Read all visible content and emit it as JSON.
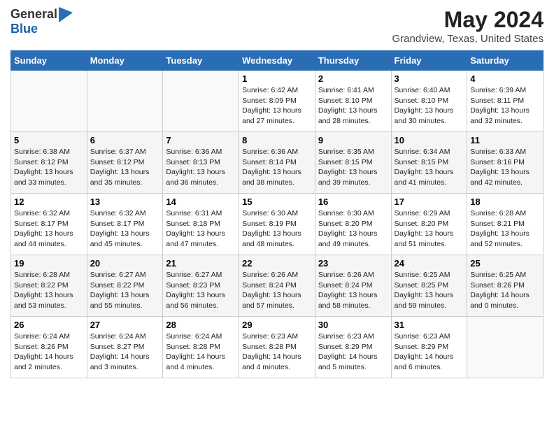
{
  "header": {
    "logo_general": "General",
    "logo_blue": "Blue",
    "title": "May 2024",
    "subtitle": "Grandview, Texas, United States"
  },
  "days_of_week": [
    "Sunday",
    "Monday",
    "Tuesday",
    "Wednesday",
    "Thursday",
    "Friday",
    "Saturday"
  ],
  "weeks": [
    [
      {
        "day": "",
        "info": ""
      },
      {
        "day": "",
        "info": ""
      },
      {
        "day": "",
        "info": ""
      },
      {
        "day": "1",
        "info": "Sunrise: 6:42 AM\nSunset: 8:09 PM\nDaylight: 13 hours and 27 minutes."
      },
      {
        "day": "2",
        "info": "Sunrise: 6:41 AM\nSunset: 8:10 PM\nDaylight: 13 hours and 28 minutes."
      },
      {
        "day": "3",
        "info": "Sunrise: 6:40 AM\nSunset: 8:10 PM\nDaylight: 13 hours and 30 minutes."
      },
      {
        "day": "4",
        "info": "Sunrise: 6:39 AM\nSunset: 8:11 PM\nDaylight: 13 hours and 32 minutes."
      }
    ],
    [
      {
        "day": "5",
        "info": "Sunrise: 6:38 AM\nSunset: 8:12 PM\nDaylight: 13 hours and 33 minutes."
      },
      {
        "day": "6",
        "info": "Sunrise: 6:37 AM\nSunset: 8:12 PM\nDaylight: 13 hours and 35 minutes."
      },
      {
        "day": "7",
        "info": "Sunrise: 6:36 AM\nSunset: 8:13 PM\nDaylight: 13 hours and 36 minutes."
      },
      {
        "day": "8",
        "info": "Sunrise: 6:36 AM\nSunset: 8:14 PM\nDaylight: 13 hours and 38 minutes."
      },
      {
        "day": "9",
        "info": "Sunrise: 6:35 AM\nSunset: 8:15 PM\nDaylight: 13 hours and 39 minutes."
      },
      {
        "day": "10",
        "info": "Sunrise: 6:34 AM\nSunset: 8:15 PM\nDaylight: 13 hours and 41 minutes."
      },
      {
        "day": "11",
        "info": "Sunrise: 6:33 AM\nSunset: 8:16 PM\nDaylight: 13 hours and 42 minutes."
      }
    ],
    [
      {
        "day": "12",
        "info": "Sunrise: 6:32 AM\nSunset: 8:17 PM\nDaylight: 13 hours and 44 minutes."
      },
      {
        "day": "13",
        "info": "Sunrise: 6:32 AM\nSunset: 8:17 PM\nDaylight: 13 hours and 45 minutes."
      },
      {
        "day": "14",
        "info": "Sunrise: 6:31 AM\nSunset: 8:18 PM\nDaylight: 13 hours and 47 minutes."
      },
      {
        "day": "15",
        "info": "Sunrise: 6:30 AM\nSunset: 8:19 PM\nDaylight: 13 hours and 48 minutes."
      },
      {
        "day": "16",
        "info": "Sunrise: 6:30 AM\nSunset: 8:20 PM\nDaylight: 13 hours and 49 minutes."
      },
      {
        "day": "17",
        "info": "Sunrise: 6:29 AM\nSunset: 8:20 PM\nDaylight: 13 hours and 51 minutes."
      },
      {
        "day": "18",
        "info": "Sunrise: 6:28 AM\nSunset: 8:21 PM\nDaylight: 13 hours and 52 minutes."
      }
    ],
    [
      {
        "day": "19",
        "info": "Sunrise: 6:28 AM\nSunset: 8:22 PM\nDaylight: 13 hours and 53 minutes."
      },
      {
        "day": "20",
        "info": "Sunrise: 6:27 AM\nSunset: 8:22 PM\nDaylight: 13 hours and 55 minutes."
      },
      {
        "day": "21",
        "info": "Sunrise: 6:27 AM\nSunset: 8:23 PM\nDaylight: 13 hours and 56 minutes."
      },
      {
        "day": "22",
        "info": "Sunrise: 6:26 AM\nSunset: 8:24 PM\nDaylight: 13 hours and 57 minutes."
      },
      {
        "day": "23",
        "info": "Sunrise: 6:26 AM\nSunset: 8:24 PM\nDaylight: 13 hours and 58 minutes."
      },
      {
        "day": "24",
        "info": "Sunrise: 6:25 AM\nSunset: 8:25 PM\nDaylight: 13 hours and 59 minutes."
      },
      {
        "day": "25",
        "info": "Sunrise: 6:25 AM\nSunset: 8:26 PM\nDaylight: 14 hours and 0 minutes."
      }
    ],
    [
      {
        "day": "26",
        "info": "Sunrise: 6:24 AM\nSunset: 8:26 PM\nDaylight: 14 hours and 2 minutes."
      },
      {
        "day": "27",
        "info": "Sunrise: 6:24 AM\nSunset: 8:27 PM\nDaylight: 14 hours and 3 minutes."
      },
      {
        "day": "28",
        "info": "Sunrise: 6:24 AM\nSunset: 8:28 PM\nDaylight: 14 hours and 4 minutes."
      },
      {
        "day": "29",
        "info": "Sunrise: 6:23 AM\nSunset: 8:28 PM\nDaylight: 14 hours and 4 minutes."
      },
      {
        "day": "30",
        "info": "Sunrise: 6:23 AM\nSunset: 8:29 PM\nDaylight: 14 hours and 5 minutes."
      },
      {
        "day": "31",
        "info": "Sunrise: 6:23 AM\nSunset: 8:29 PM\nDaylight: 14 hours and 6 minutes."
      },
      {
        "day": "",
        "info": ""
      }
    ]
  ]
}
